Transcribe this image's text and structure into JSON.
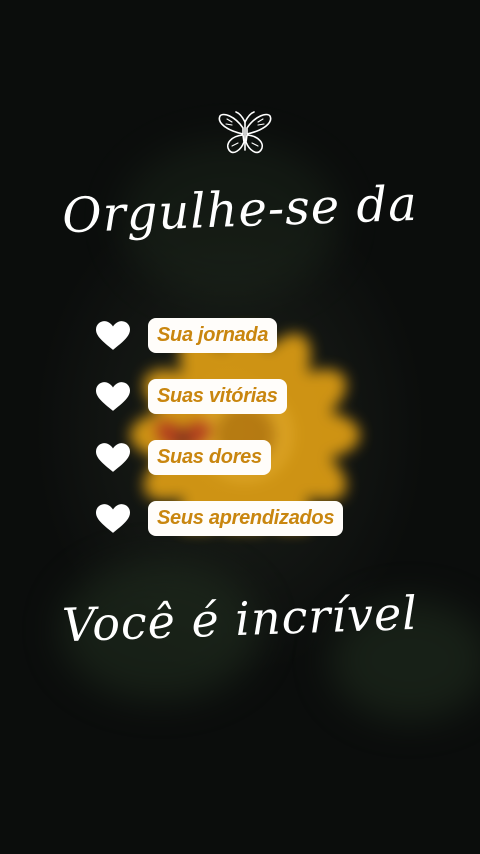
{
  "headline_top": "Orgulhe-se da",
  "list": {
    "items": [
      {
        "label": "Sua jornada"
      },
      {
        "label": "Suas vitórias"
      },
      {
        "label": "Suas dores"
      },
      {
        "label": "Seus aprendizados"
      }
    ]
  },
  "headline_bottom": "Você é incrível",
  "colors": {
    "background": "#0b0d0c",
    "pill_text": "#c9860f",
    "pill_bg": "#fffdfa",
    "heart": "#ffffff",
    "flower": "#e8a010"
  },
  "icons": {
    "top": "butterfly-icon",
    "bullet": "heart-icon"
  }
}
